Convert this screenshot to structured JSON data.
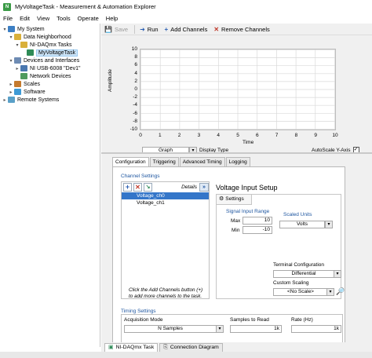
{
  "window": {
    "title": "MyVoltageTask - Measurement & Automation Explorer",
    "icon_label": "N"
  },
  "menu": [
    "File",
    "Edit",
    "View",
    "Tools",
    "Operate",
    "Help"
  ],
  "tree": [
    {
      "label": "My System",
      "expanded": true,
      "icon": "computer-icon"
    },
    {
      "label": "Data Neighborhood",
      "expanded": true,
      "icon": "folder-icon"
    },
    {
      "label": "NI-DAQmx Tasks",
      "expanded": true,
      "icon": "folder-icon"
    },
    {
      "label": "MyVoltageTask",
      "selected": true,
      "icon": "task-icon"
    },
    {
      "label": "Devices and Interfaces",
      "expanded": true,
      "icon": "devices-icon"
    },
    {
      "label": "NI USB-6008 \"Dev1\"",
      "expanded": false,
      "icon": "usb-device-icon"
    },
    {
      "label": "Network Devices",
      "icon": "network-icon"
    },
    {
      "label": "Scales",
      "expanded": false,
      "icon": "scales-icon"
    },
    {
      "label": "Software",
      "expanded": false,
      "icon": "software-icon"
    },
    {
      "label": "Remote Systems",
      "expanded": false,
      "icon": "remote-systems-icon"
    }
  ],
  "toolbar": {
    "save": "Save",
    "run": "Run",
    "add_channels": "Add Channels",
    "remove_channels": "Remove Channels"
  },
  "chart_data": {
    "type": "line",
    "title": "",
    "xlabel": "Time",
    "ylabel": "Amplitude",
    "x_ticks": [
      "0",
      "1",
      "2",
      "3",
      "4",
      "5",
      "6",
      "7",
      "8",
      "9",
      "10"
    ],
    "y_ticks": [
      "10",
      "8",
      "6",
      "4",
      "2",
      "0",
      "-2",
      "-4",
      "-6",
      "-8",
      "-10"
    ],
    "xlim": [
      0,
      10
    ],
    "ylim": [
      -10,
      10
    ],
    "grid": true,
    "series": []
  },
  "display": {
    "type_value": "Graph",
    "type_label": "Display Type",
    "autoscale_label": "AutoScale Y-Axis",
    "autoscale_checked": true
  },
  "tabs": [
    "Configuration",
    "Triggering",
    "Advanced Timing",
    "Logging"
  ],
  "channel_settings": {
    "title": "Channel Settings",
    "details_label": "Details",
    "channels": [
      "Voltage_ch0",
      "Voltage_ch1"
    ],
    "hint": "Click the Add Channels button (+) to add more channels to the task."
  },
  "voltage_setup": {
    "title": "Voltage Input Setup",
    "settings_tab": "Settings",
    "signal_range_title": "Signal Input Range",
    "max_label": "Max",
    "max_value": "10",
    "min_label": "Min",
    "min_value": "-10",
    "scaled_units_label": "Scaled Units",
    "scaled_units_value": "Volts",
    "terminal_label": "Terminal Configuration",
    "terminal_value": "Differential",
    "custom_scaling_label": "Custom Scaling",
    "custom_scaling_value": "<No Scale>"
  },
  "timing": {
    "title": "Timing Settings",
    "acq_mode_label": "Acquisition Mode",
    "acq_mode_value": "N Samples",
    "samples_label": "Samples to Read",
    "samples_value": "1k",
    "rate_label": "Rate (Hz)",
    "rate_value": "1k"
  },
  "bottom_tabs": [
    "NI-DAQmx Task",
    "Connection Diagram"
  ]
}
